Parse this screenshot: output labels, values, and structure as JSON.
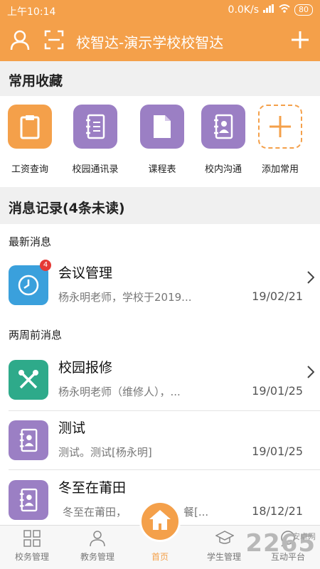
{
  "status_bar": {
    "time": "上午10:14",
    "speed": "0.0K/s",
    "battery": "80"
  },
  "header": {
    "title": "校智达-演示学校校智达"
  },
  "favorites": {
    "heading": "常用收藏",
    "items": [
      {
        "label": "工资查询",
        "icon": "clipboard-icon",
        "color": "#f4a04a"
      },
      {
        "label": "校园通讯录",
        "icon": "notebook-icon",
        "color": "#9b7fc4"
      },
      {
        "label": "课程表",
        "icon": "document-icon",
        "color": "#9b7fc4"
      },
      {
        "label": "校内沟通",
        "icon": "contacts-book-icon",
        "color": "#9b7fc4"
      },
      {
        "label": "添加常用",
        "icon": "plus-icon",
        "color": "#f4a04a"
      }
    ]
  },
  "messages": {
    "heading": "消息记录(4条未读)",
    "group_latest": "最新消息",
    "group_two_weeks": "两周前消息",
    "rows": [
      {
        "name": "会议管理",
        "preview": "杨永明老师，学校于2019...",
        "date": "19/02/21",
        "badge": "4",
        "icon": "clock-icon",
        "color": "#3aa0dc"
      },
      {
        "name": "校园报修",
        "preview": "杨永明老师（维修人），...",
        "date": "19/01/25",
        "icon": "tools-icon",
        "color": "#2eaa8a"
      },
      {
        "name": "测试",
        "preview": "测试。测试[杨永明]",
        "date": "19/01/25",
        "icon": "contacts-book-icon",
        "color": "#9b7fc4"
      },
      {
        "name": "冬至在莆田",
        "preview": "冬至在莆田，",
        "preview_tail": "餐[...",
        "date": "18/12/21",
        "icon": "contacts-book-icon",
        "color": "#9b7fc4"
      }
    ]
  },
  "tabs": [
    {
      "label": "校务管理",
      "icon": "grid-icon"
    },
    {
      "label": "教务管理",
      "icon": "teacher-icon"
    },
    {
      "label": "首页",
      "icon": "home-icon"
    },
    {
      "label": "学生管理",
      "icon": "graduation-cap-icon"
    },
    {
      "label": "互动平台",
      "icon": "chat-icon"
    }
  ],
  "watermark": {
    "text": "2265",
    "suffix": "安卓网"
  }
}
